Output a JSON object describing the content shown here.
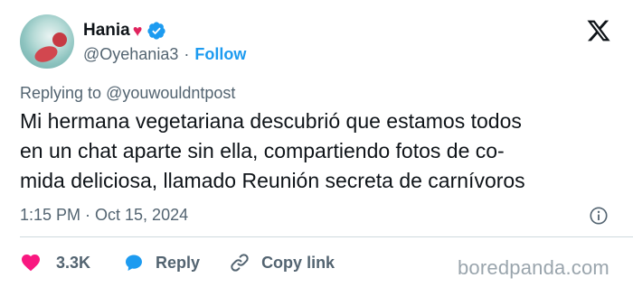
{
  "author": {
    "display_name": "Hania",
    "handle": "@Oyehania3",
    "separator": "·",
    "follow_label": "Follow",
    "heart": "♥"
  },
  "reply": {
    "prefix": "Replying to",
    "to_handle": "@youwouldntpost"
  },
  "tweet": {
    "lines": [
      "Mi hermana vegetariana descubrió que estamos todos",
      "en un chat aparte sin ella, compartiendo fotos de co-",
      "mida deliciosa, llamado Reunión secreta de carnívoros"
    ],
    "timestamp": "1:15 PM · Oct 15, 2024"
  },
  "actions": {
    "like_count": "3.3K",
    "reply_label": "Reply",
    "copy_link_label": "Copy link"
  },
  "watermark": "boredpanda.com",
  "colors": {
    "accent": "#1d9bf0",
    "like": "#f91880",
    "text": "#0f1419",
    "muted": "#536471"
  }
}
